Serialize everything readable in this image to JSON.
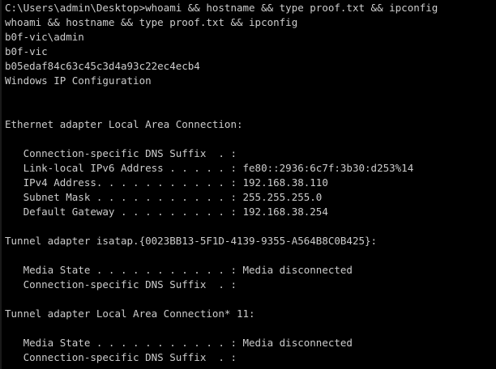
{
  "terminal": {
    "lines": [
      "C:\\Users\\admin\\Desktop>whoami && hostname && type proof.txt && ipconfig",
      "whoami && hostname && type proof.txt && ipconfig",
      "b0f-vic\\admin",
      "b0f-vic",
      "b05edaf84c63c45c3d4a93c22ec4ecb4",
      "Windows IP Configuration",
      "",
      "",
      "Ethernet adapter Local Area Connection:",
      "",
      "   Connection-specific DNS Suffix  . :",
      "   Link-local IPv6 Address . . . . . : fe80::2936:6c7f:3b30:d253%14",
      "   IPv4 Address. . . . . . . . . . . : 192.168.38.110",
      "   Subnet Mask . . . . . . . . . . . : 255.255.255.0",
      "   Default Gateway . . . . . . . . . : 192.168.38.254",
      "",
      "Tunnel adapter isatap.{0023BB13-5F1D-4139-9355-A564B8C0B425}:",
      "",
      "   Media State . . . . . . . . . . . : Media disconnected",
      "   Connection-specific DNS Suffix  . :",
      "",
      "Tunnel adapter Local Area Connection* 11:",
      "",
      "   Media State . . . . . . . . . . . : Media disconnected",
      "   Connection-specific DNS Suffix  . :"
    ]
  }
}
